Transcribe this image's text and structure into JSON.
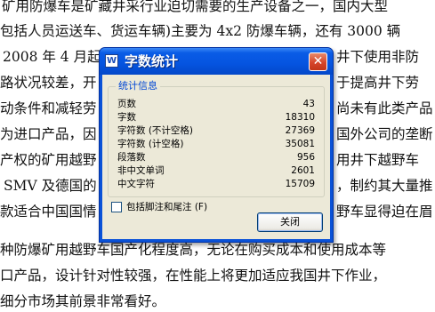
{
  "document": {
    "lines": [
      "矿用防爆车是矿藏井采行业迫切需要的生产设备之一，国内大型",
      "包括人员运送车、货运车辆)主要为 4x2 防爆车辆，还有 3000 辆",
      "2008 年 4 月起",
      "路状况较差，开",
      "动条件和减轻劳",
      "为进口产品，因",
      "产权的矿用越野",
      "SMV 及德国的",
      "款适合中国国情",
      "种防爆矿用越野车国产化程度高，无论在购买成本和使用成本等",
      "口产品，设计针对性较强，在性能上将更加适应我国井下作业，",
      "细分市场其前景非常看好。"
    ],
    "right_fragments": [
      "井下使用非防",
      "于提高井下劳",
      "尚未有此类产品",
      "国外公司的垄断",
      "用井下越野车",
      "，制约其大量推",
      "野车显得迫在眉"
    ]
  },
  "dialog": {
    "title": "字数统计",
    "app_icon": "W",
    "close_glyph": "✕",
    "group_title": "统计信息",
    "stats": [
      {
        "label": "页数",
        "value": "43"
      },
      {
        "label": "字数",
        "value": "18310"
      },
      {
        "label": "字符数 (不计空格)",
        "value": "27369"
      },
      {
        "label": "字符数 (计空格)",
        "value": "35081"
      },
      {
        "label": "段落数",
        "value": "956"
      },
      {
        "label": "非中文单词",
        "value": "2601"
      },
      {
        "label": "中文字符",
        "value": "15709"
      }
    ],
    "checkbox_label": "包括脚注和尾注 (F)",
    "checkbox_checked": false,
    "close_button": "关闭"
  },
  "colors": {
    "title_bar": "#0554e0",
    "group_title": "#0046d5",
    "dialog_body": "#ece9d8",
    "close_red": "#d6452a"
  }
}
